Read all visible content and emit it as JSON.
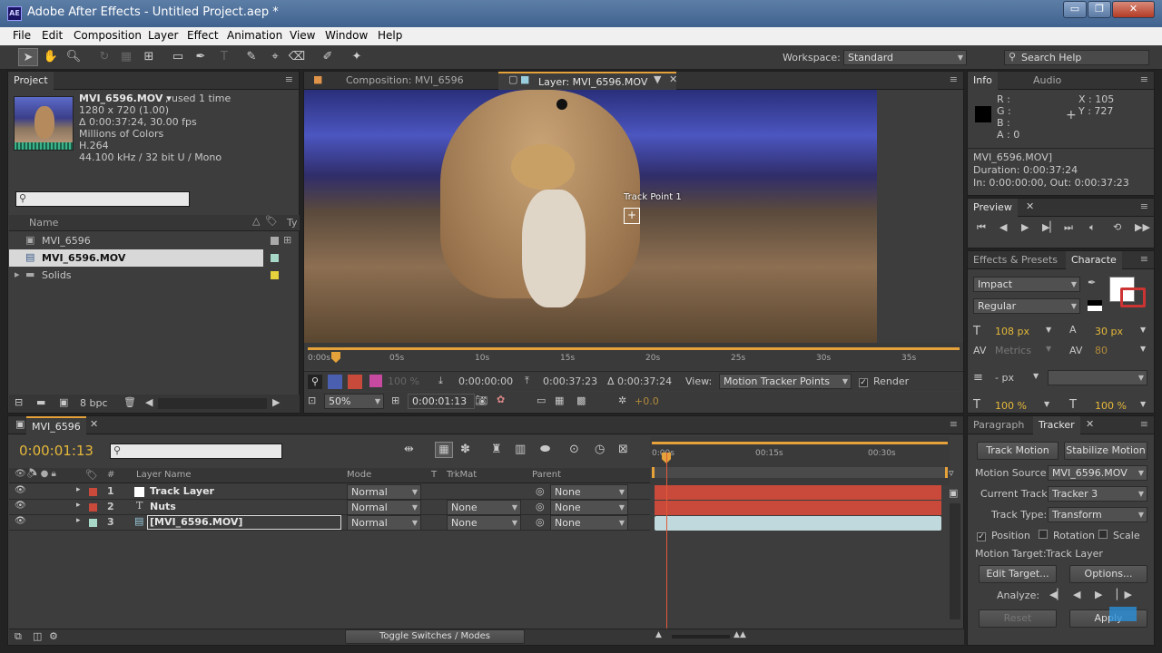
{
  "window": {
    "title": "Adobe After Effects - Untitled Project.aep *",
    "app_icon": "AE",
    "minimize": "▭",
    "restore": "❐",
    "close": "✕"
  },
  "menu": [
    "File",
    "Edit",
    "Composition",
    "Layer",
    "Effect",
    "Animation",
    "View",
    "Window",
    "Help"
  ],
  "toolbar": {
    "workspace_label": "Workspace:",
    "workspace_value": "Standard",
    "search_placeholder": "Search Help"
  },
  "project": {
    "tab": "Project",
    "item_name": "MVI_6596.MOV ▾",
    "used": ", used 1 time",
    "dims": "1280 x 720 (1.00)",
    "duration": "Δ 0:00:37:24, 30.00 fps",
    "colors": "Millions of Colors",
    "codec": "H.264",
    "audio": "44.100 kHz / 32 bit U / Mono",
    "col_name": "Name",
    "col_type": "Ty",
    "items": [
      {
        "name": "MVI_6596",
        "color": "#aaaaaa"
      },
      {
        "name": "MVI_6596.MOV",
        "color": "#a8d8c8"
      },
      {
        "name": "Solids",
        "color": "#e6d23c"
      }
    ],
    "bpc": "8 bpc"
  },
  "viewer": {
    "tab_comp": "Composition: MVI_6596",
    "tab_layer": "Layer: MVI_6596.MOV",
    "track_label": "Track Point 1",
    "ruler": [
      "0:00s",
      "05s",
      "10s",
      "15s",
      "20s",
      "25s",
      "30s",
      "35s"
    ],
    "in_time": "0:00:00:00",
    "out_time": "0:00:37:23",
    "dur_time": "Δ 0:00:37:24",
    "view_label": "View:",
    "view_value": "Motion Tracker Points",
    "render_label": "Render",
    "zoom": "50%",
    "timecode": "0:00:01:13",
    "opacity": "100 %",
    "offset": "+0.0"
  },
  "info": {
    "tab_info": "Info",
    "tab_audio": "Audio",
    "r": "R :",
    "g": "G :",
    "b": "B :",
    "a": "A : 0",
    "x": "X : 105",
    "y": "Y : 727",
    "file": "MVI_6596.MOV]",
    "duration": "Duration: 0:00:37:24",
    "inout": "In: 0:00:00:00, Out: 0:00:37:23"
  },
  "preview": {
    "tab": "Preview"
  },
  "character": {
    "tab_effects": "Effects & Presets",
    "tab_char": "Characte",
    "font": "Impact",
    "style": "Regular",
    "size": "108 px",
    "leading": "30 px",
    "kerning": "Metrics",
    "tracking": "80",
    "stroke": "- px",
    "vscale": "100 %",
    "hscale": "100 %"
  },
  "timeline": {
    "tab": "MVI_6596",
    "time": "0:00:01:13",
    "cols": {
      "num": "#",
      "name": "Layer Name",
      "mode": "Mode",
      "t": "T",
      "trkmat": "TrkMat",
      "parent": "Parent"
    },
    "ruler": [
      "0:00s",
      "00:15s",
      "00:30s"
    ],
    "layers": [
      {
        "num": "1",
        "name": "Track Layer",
        "mode": "Normal",
        "trkmat": "",
        "parent": "None",
        "color": "#c94a3a",
        "bar": "#c94a3a"
      },
      {
        "num": "2",
        "name": "Nuts",
        "mode": "Normal",
        "trkmat": "None",
        "parent": "None",
        "color": "#c94a3a",
        "bar": "#c94a3a"
      },
      {
        "num": "3",
        "name": "[MVI_6596.MOV]",
        "mode": "Normal",
        "trkmat": "None",
        "parent": "None",
        "color": "#a8d8c8",
        "bar": "#bfd9dc"
      }
    ],
    "toggle": "Toggle Switches / Modes"
  },
  "tracker": {
    "tab_par": "Paragraph",
    "tab_tracker": "Tracker",
    "track_motion": "Track Motion",
    "stabilize": "Stabilize Motion",
    "src_label": "Motion Source:",
    "src_value": "MVI_6596.MOV",
    "cur_label": "Current Track:",
    "cur_value": "Tracker 3",
    "type_label": "Track Type:",
    "type_value": "Transform",
    "position": "Position",
    "rotation": "Rotation",
    "scale": "Scale",
    "target_label": "Motion Target:",
    "target_value": "Track Layer",
    "edit_target": "Edit Target...",
    "options": "Options...",
    "analyze": "Analyze:",
    "reset": "Reset",
    "apply": "Apply"
  },
  "colors": {
    "accent": "#e6a23a",
    "playhead": "#e05a3a"
  }
}
